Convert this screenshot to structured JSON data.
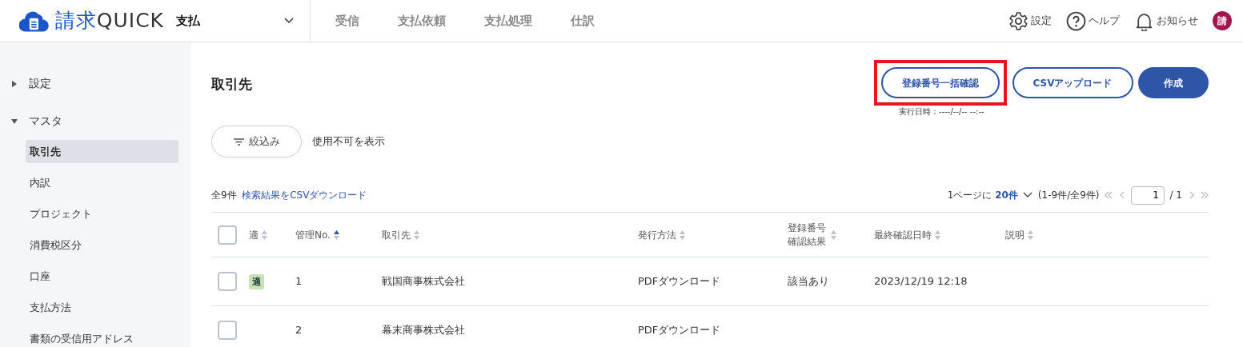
{
  "header": {
    "logo_text": "請求QUICK",
    "module": "支払",
    "nav": [
      {
        "label": "受信",
        "selected": false
      },
      {
        "label": "支払依頼",
        "selected": false
      },
      {
        "label": "支払処理",
        "selected": false
      },
      {
        "label": "仕訳",
        "selected": false
      }
    ],
    "tools": [
      {
        "kind": "settings",
        "label": "設定"
      },
      {
        "kind": "help",
        "label": "ヘルプ"
      },
      {
        "kind": "bell",
        "label": "お知らせ"
      }
    ],
    "avatar": "請"
  },
  "sidebar": {
    "items": [
      {
        "label": "設定",
        "expanded": false
      },
      {
        "label": "マスタ",
        "expanded": true,
        "children": [
          {
            "label": "取引先",
            "selected": true
          },
          {
            "label": "内訳",
            "selected": false
          },
          {
            "label": "プロジェクト",
            "selected": false
          },
          {
            "label": "消費税区分",
            "selected": false
          },
          {
            "label": "口座",
            "selected": false
          },
          {
            "label": "支払方法",
            "selected": false
          },
          {
            "label": "書類の受信用アドレス",
            "selected": false
          }
        ]
      }
    ]
  },
  "page": {
    "title": "取引先",
    "buttons": [
      {
        "label": "登録番号一括確認",
        "kind": "outline",
        "highlighted": true
      },
      {
        "label": "CSVアップロード",
        "kind": "outline",
        "highlighted": false
      },
      {
        "label": "作成",
        "kind": "primary",
        "highlighted": false
      }
    ],
    "last_run": "実行日時：----/--/-- --:--",
    "filter_button": "絞込み",
    "show_disabled": "使用不可を表示"
  },
  "table": {
    "count": "全9件",
    "csv_link": "検索結果をCSVダウンロード",
    "pagination": {
      "per_page_prefix": "1ページに",
      "per_page": "20件",
      "range": "(1-9件/全9件)",
      "page": "1",
      "total": "/ 1"
    },
    "select_all_checked": false,
    "columns": [
      {
        "label": "適",
        "sorted_ascending": false
      },
      {
        "label": "管理No.",
        "sorted_ascending": true
      },
      {
        "label": "取引先",
        "sorted_ascending": false
      },
      {
        "label": "発行方法",
        "sorted_ascending": false
      },
      {
        "label": "登録番号確認結果",
        "sorted_ascending": false
      },
      {
        "label": "最終確認日時",
        "sorted_ascending": false
      },
      {
        "label": "説明",
        "sorted_ascending": false
      }
    ],
    "rows": [
      {
        "checked": false,
        "cells": [
          "適",
          "1",
          "戦国商事株式会社",
          "PDFダウンロード",
          "該当あり",
          "2023/12/19 12:18",
          ""
        ]
      },
      {
        "checked": false,
        "cells": [
          "",
          "2",
          "幕末商事株式会社",
          "PDFダウンロード",
          "",
          "",
          ""
        ]
      }
    ]
  }
}
